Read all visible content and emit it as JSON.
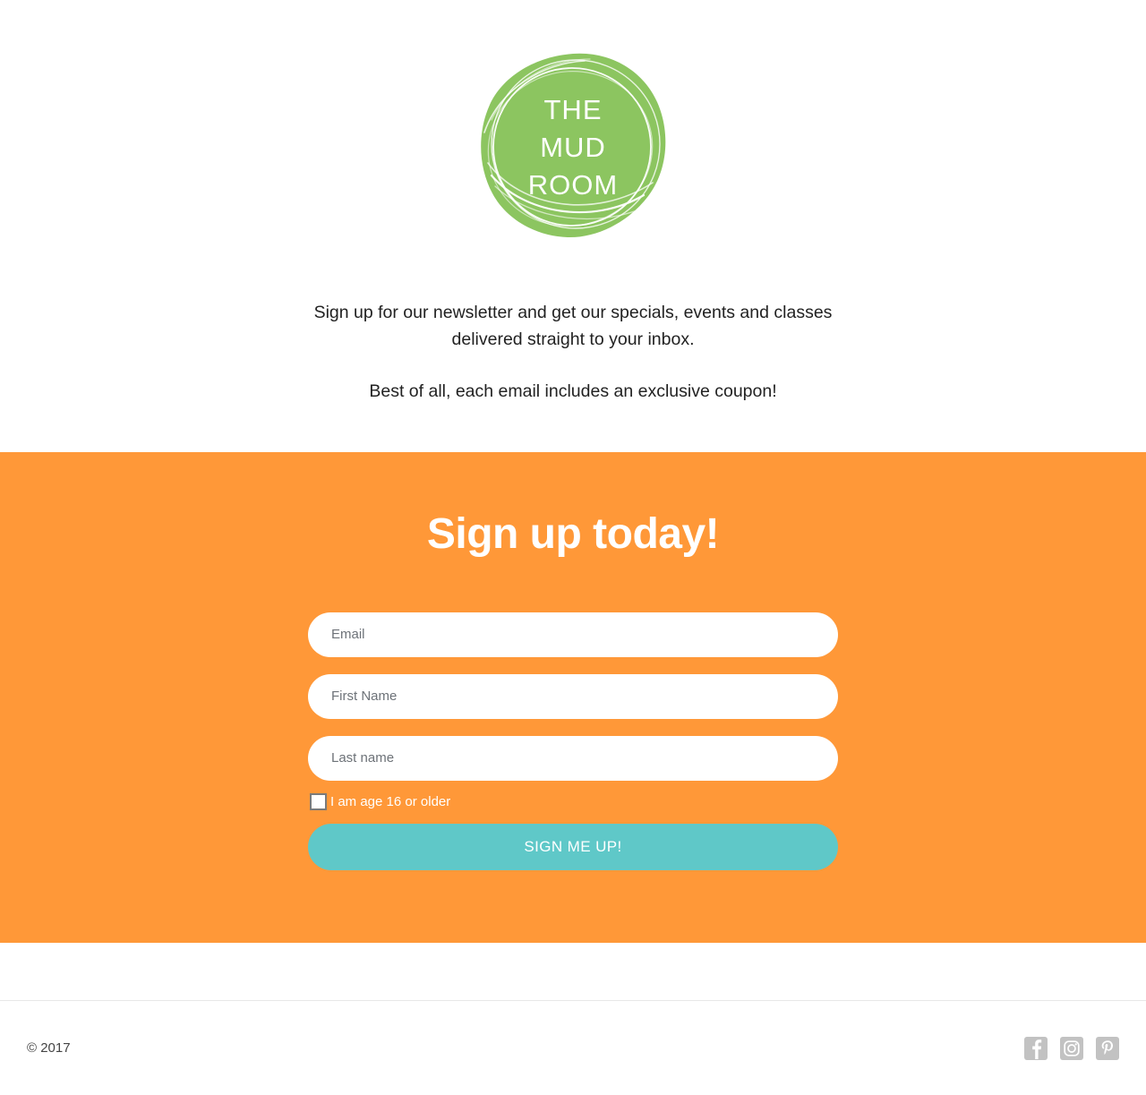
{
  "brand": {
    "logo_lines": [
      "THE",
      "MUD",
      "ROOM"
    ],
    "logo_color": "#8CC560",
    "logo_text_color": "#FFFFFF",
    "logo_name": "The Mud Room"
  },
  "intro": {
    "line1": "Sign up for our newsletter and get our specials, events and classes delivered straight to your inbox.",
    "line2": "Best of all, each email includes an exclusive coupon!"
  },
  "signup": {
    "title": "Sign up today!",
    "background_color": "#FF9838",
    "fields": [
      {
        "name": "email",
        "placeholder": "Email",
        "value": ""
      },
      {
        "name": "first_name",
        "placeholder": "First Name",
        "value": ""
      },
      {
        "name": "last_name",
        "placeholder": "Last name",
        "value": ""
      }
    ],
    "consent": {
      "label": "I am age 16 or older",
      "checked": false
    },
    "submit": {
      "label": "SIGN ME UP!",
      "color": "#5FC8C8",
      "text_color": "#FFFFFF"
    }
  },
  "footer": {
    "copyright": "© 2017",
    "socials": [
      {
        "name": "facebook-icon",
        "label": "Facebook"
      },
      {
        "name": "instagram-icon",
        "label": "Instagram"
      },
      {
        "name": "pinterest-icon",
        "label": "Pinterest"
      }
    ],
    "social_color": "#C2C2C2"
  }
}
